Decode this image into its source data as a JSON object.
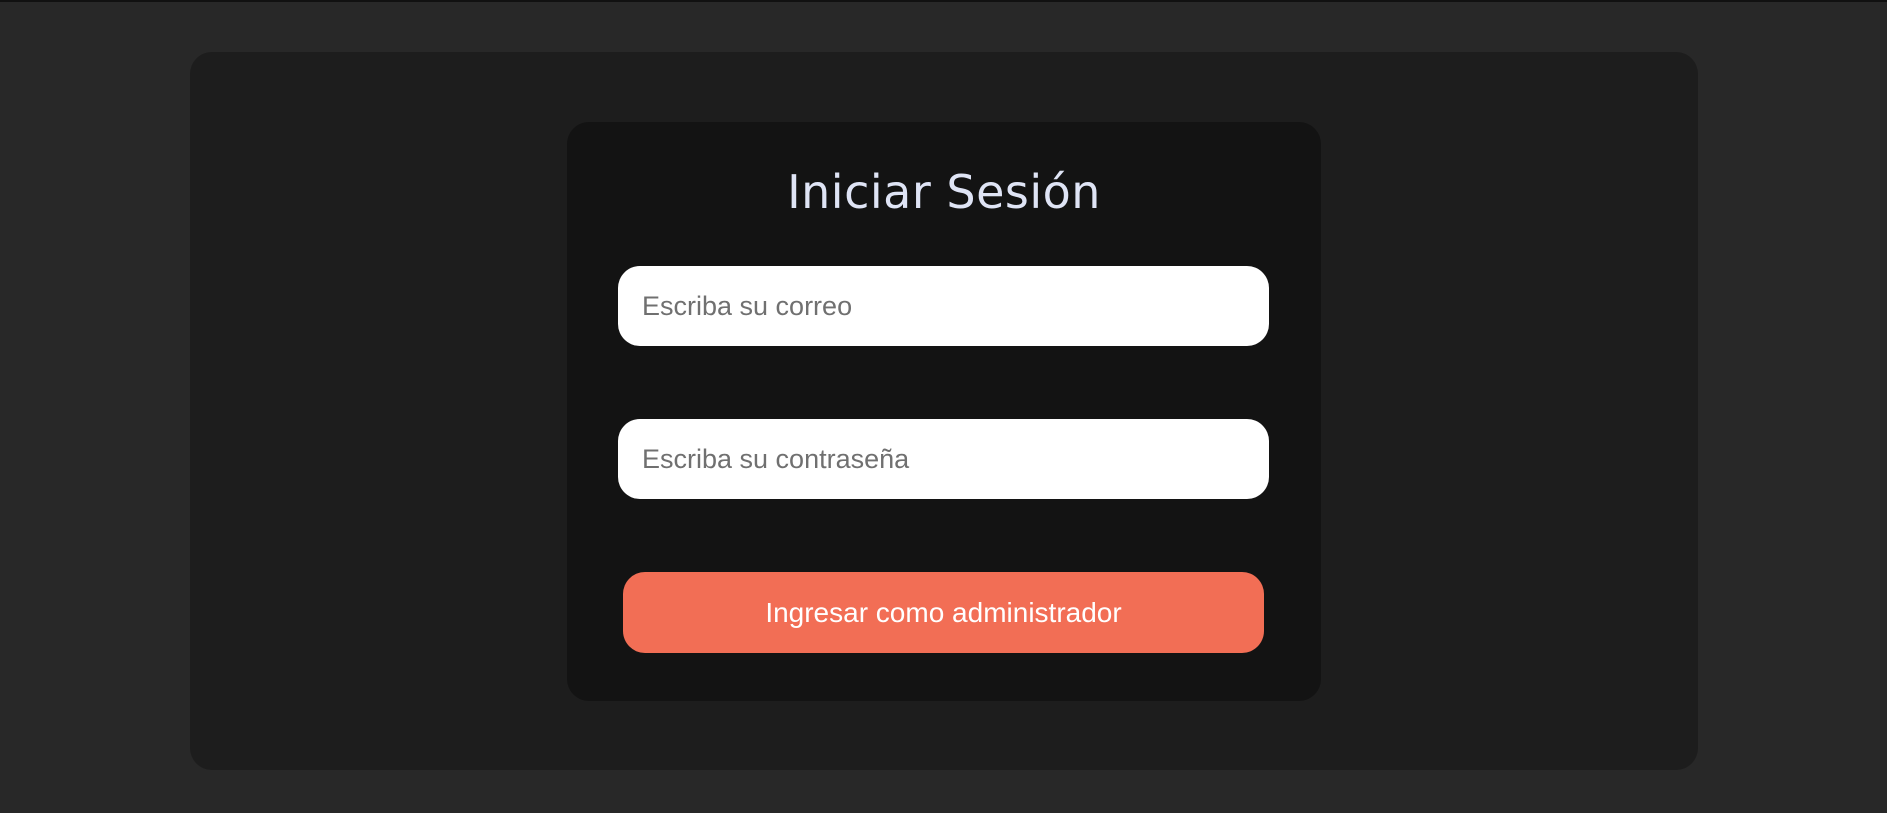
{
  "login": {
    "title": "Iniciar Sesión",
    "email": {
      "value": "",
      "placeholder": "Escriba su correo"
    },
    "password": {
      "value": "",
      "placeholder": "Escriba su contraseña"
    },
    "submit_label": "Ingresar como administrador"
  },
  "colors": {
    "page_background": "#282828",
    "panel_background": "#1d1d1d",
    "card_background": "#131313",
    "title_text": "#dfe4f5",
    "button_accent": "#f26e55"
  }
}
